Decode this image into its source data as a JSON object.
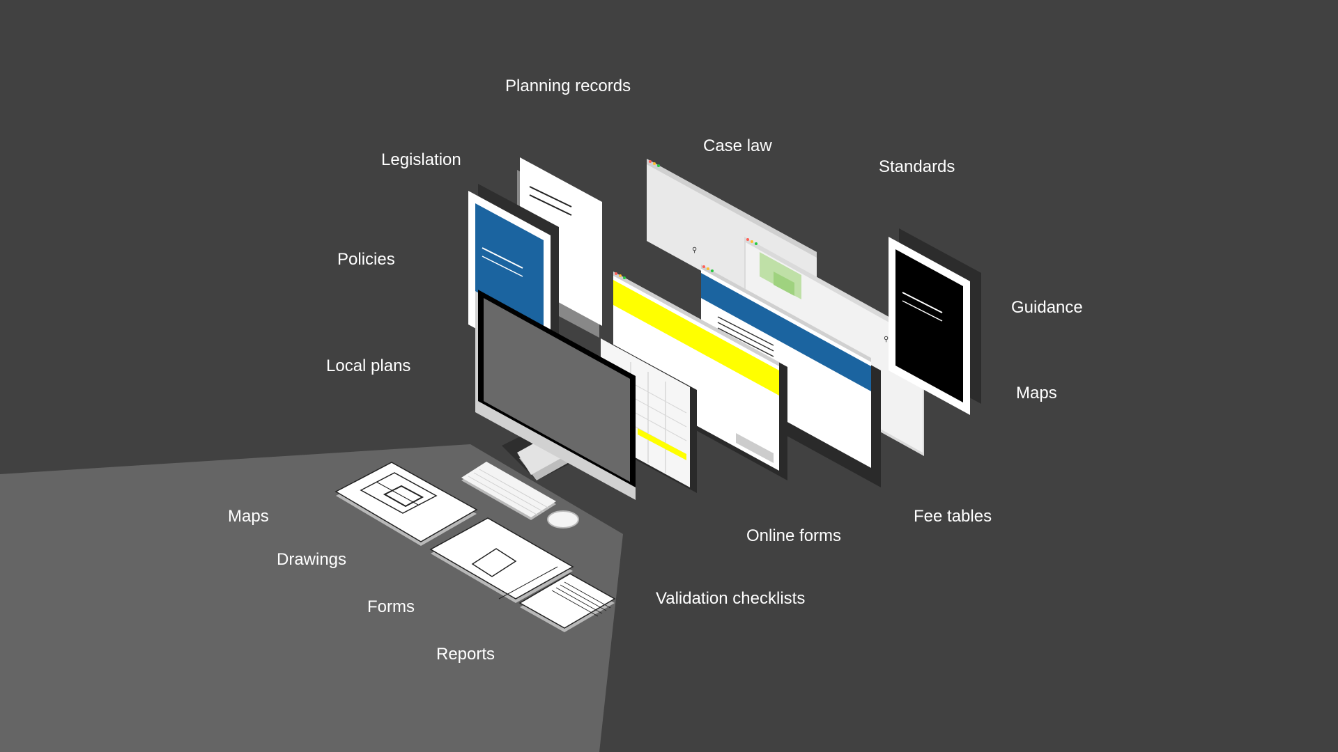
{
  "labels": {
    "planning_records": "Planning records",
    "legislation": "Legislation",
    "case_law": "Case law",
    "standards": "Standards",
    "policies": "Policies",
    "guidance": "Guidance",
    "local_plans": "Local plans",
    "maps_right": "Maps",
    "maps_left": "Maps",
    "drawings": "Drawings",
    "forms": "Forms",
    "reports": "Reports",
    "online_forms": "Online forms",
    "fee_tables": "Fee tables",
    "validation_checklists": "Validation checklists"
  },
  "colors": {
    "background": "#414141",
    "desk": "#656565",
    "policy_blue": "#1b64a0",
    "highlight_yellow": "#ffff00",
    "guidance_black": "#000000",
    "map_green": "#bfe0a7",
    "paper_white": "#ffffff"
  }
}
